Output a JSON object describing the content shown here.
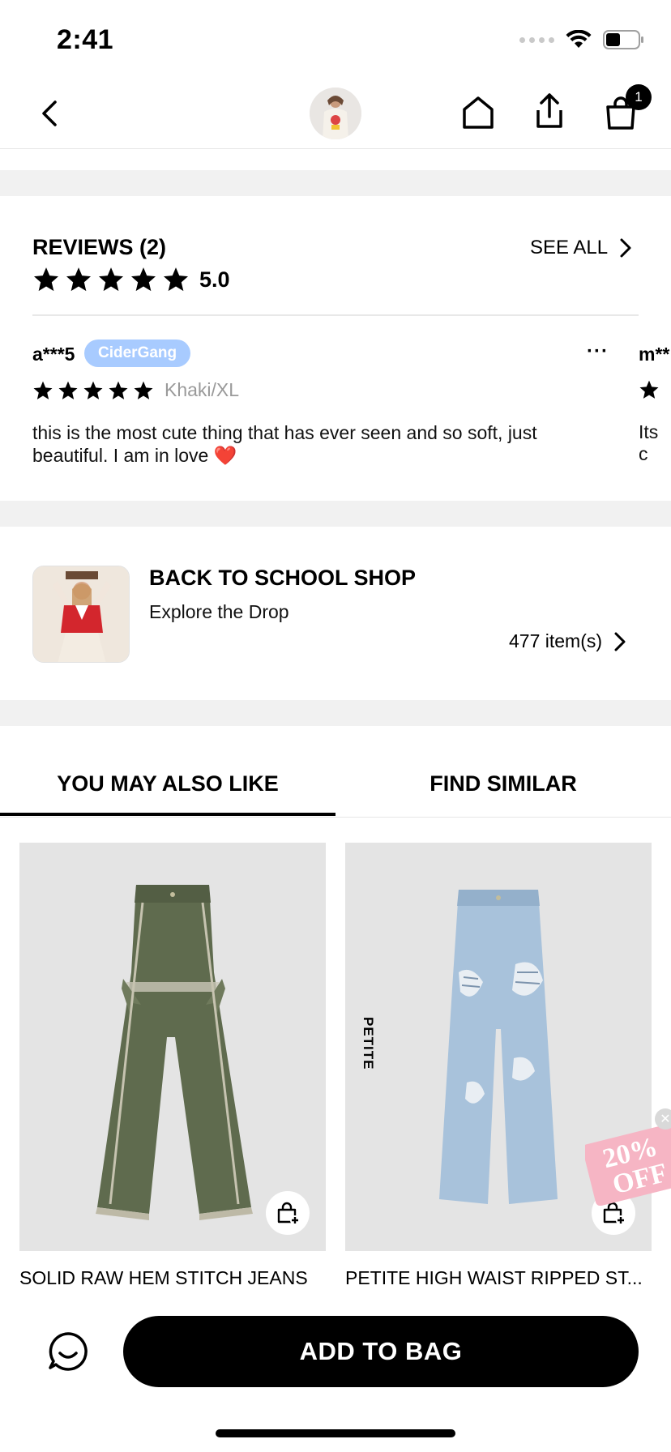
{
  "status_bar": {
    "time": "2:41"
  },
  "nav": {
    "cart_count": "1"
  },
  "reviews": {
    "title": "REVIEWS (2)",
    "see_all": "SEE ALL",
    "rating": "5.0",
    "items": [
      {
        "user": "a***5",
        "badge": "CiderGang",
        "variant": "Khaki/XL",
        "text": "this is the most cute thing that has ever seen and so soft, just beautiful. I am in love ❤️"
      },
      {
        "user": "m**",
        "text": "Its c"
      }
    ]
  },
  "shop": {
    "title": "BACK TO SCHOOL SHOP",
    "subtitle": "Explore the Drop",
    "count": "477 item(s)"
  },
  "tabs": [
    {
      "label": "YOU MAY ALSO LIKE",
      "active": true
    },
    {
      "label": "FIND SIMILAR",
      "active": false
    }
  ],
  "products": [
    {
      "name": "SOLID RAW HEM STITCH JEANS",
      "color": "#5f6b4e"
    },
    {
      "name": "PETITE HIGH WAIST RIPPED ST...",
      "tag": "PETITE",
      "color": "#a8c2db"
    }
  ],
  "promo": {
    "text1": "20%",
    "text2": "OFF"
  },
  "bottom": {
    "add_to_bag": "ADD TO BAG"
  }
}
